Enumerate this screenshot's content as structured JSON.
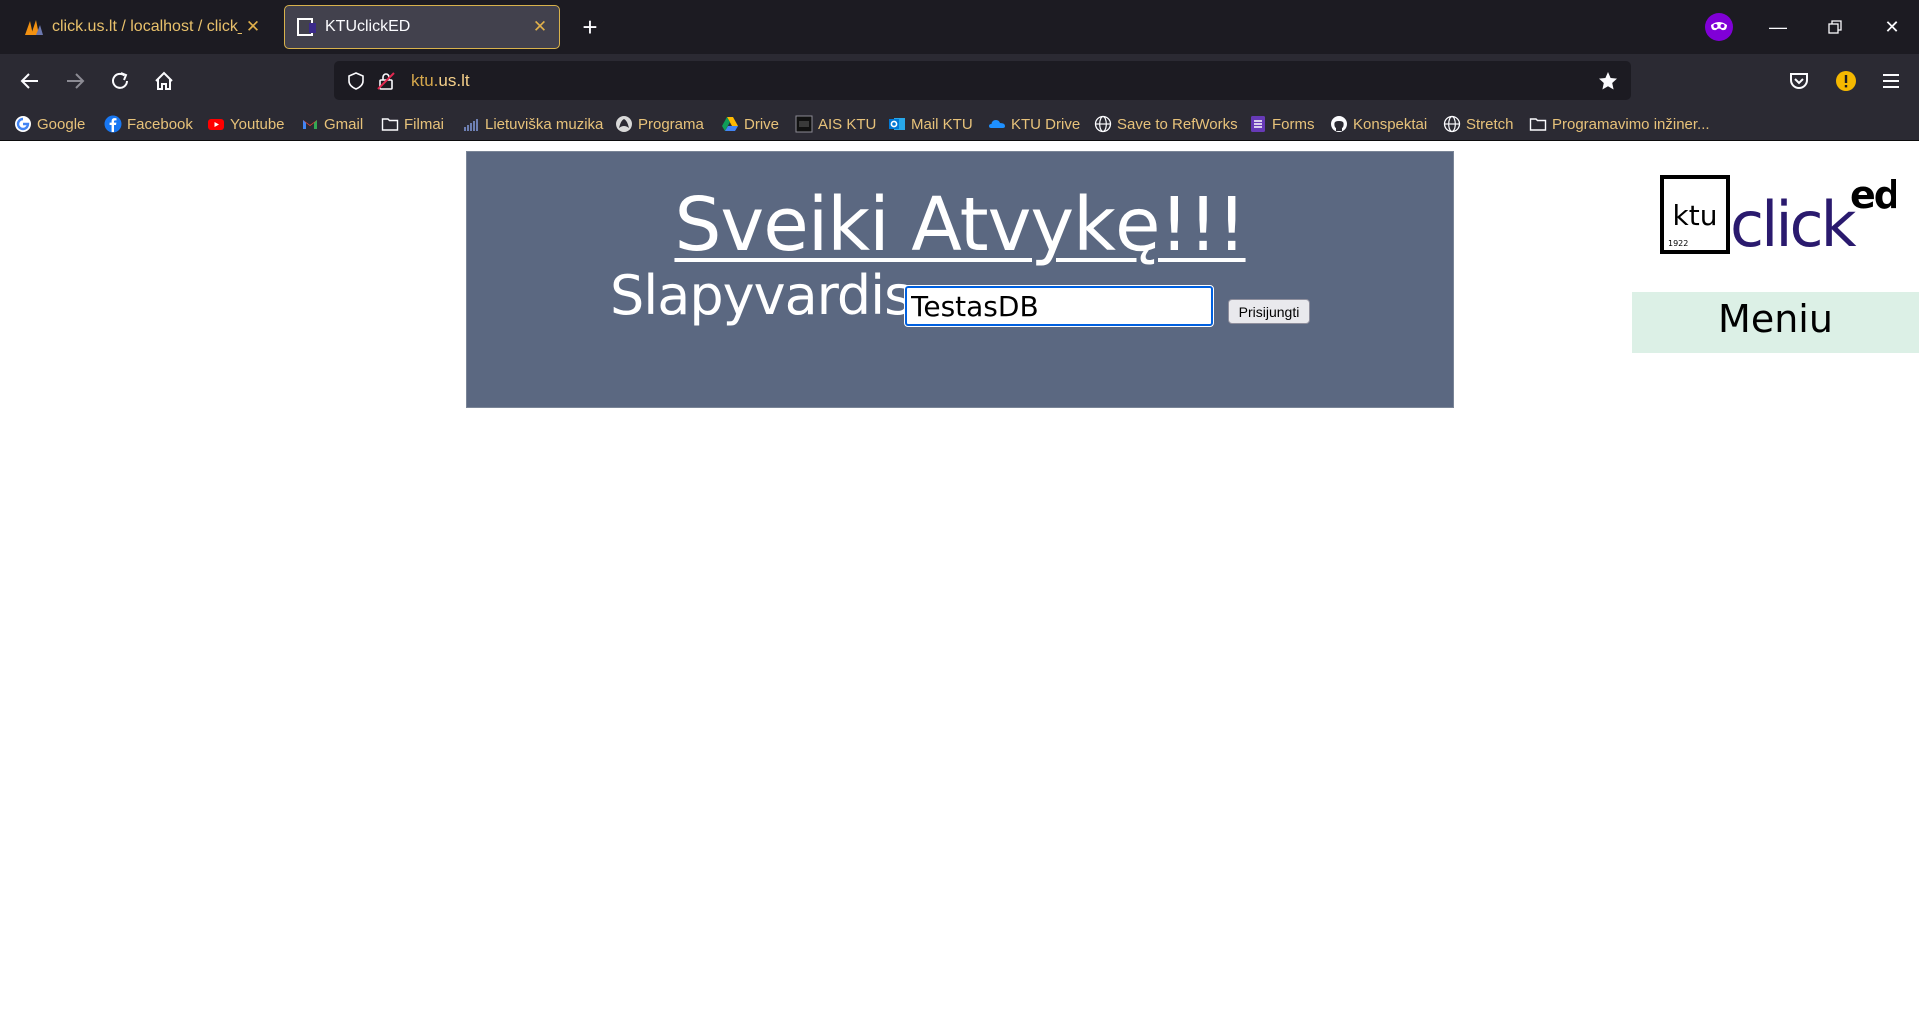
{
  "browser": {
    "tabs": [
      {
        "title": "click.us.lt / localhost / click_game"
      },
      {
        "title": "KTUclickED"
      }
    ],
    "url": {
      "prefix": "ktu.",
      "domain": "us.lt"
    },
    "bookmarks": [
      {
        "label": "Google",
        "icon": "google-icon"
      },
      {
        "label": "Facebook",
        "icon": "facebook-icon"
      },
      {
        "label": "Youtube",
        "icon": "youtube-icon"
      },
      {
        "label": "Gmail",
        "icon": "gmail-icon"
      },
      {
        "label": "Filmai",
        "icon": "folder-icon"
      },
      {
        "label": "Lietuviška muzika",
        "icon": "music-icon"
      },
      {
        "label": "Programa",
        "icon": "program-icon"
      },
      {
        "label": "Drive",
        "icon": "drive-icon"
      },
      {
        "label": "AIS KTU",
        "icon": "ais-icon"
      },
      {
        "label": "Mail KTU",
        "icon": "outlook-icon"
      },
      {
        "label": "KTU Drive",
        "icon": "onedrive-icon"
      },
      {
        "label": "Save to RefWorks",
        "icon": "globe-icon"
      },
      {
        "label": "Forms",
        "icon": "forms-icon"
      },
      {
        "label": "Konspektai",
        "icon": "github-icon"
      },
      {
        "label": "Stretch",
        "icon": "globe-icon"
      },
      {
        "label": "Programavimo inžiner...",
        "icon": "folder-icon"
      }
    ]
  },
  "page": {
    "heading": "Sveiki Atvykę!!!",
    "nickname_label": "Slapyvardis",
    "nickname_value": "TestasDB",
    "login_button": "Prisijungti",
    "logo": {
      "box_text": "ktu",
      "year": "1922",
      "word": "click",
      "sup": "ed"
    },
    "menu_label": "Meniu"
  },
  "colors": {
    "panel": "#5b6881",
    "menu_bg": "#dcf0e6",
    "logo_purple": "#2a1a6e"
  }
}
